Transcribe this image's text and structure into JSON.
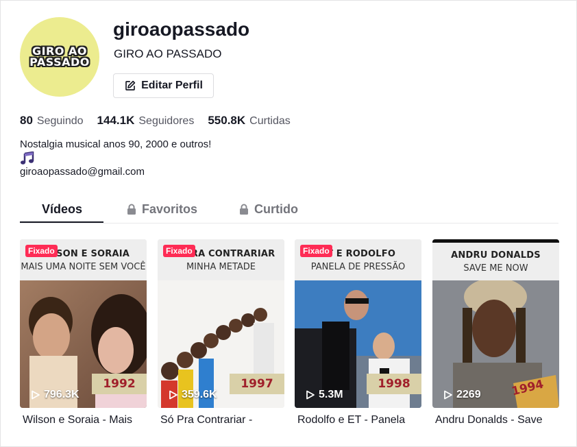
{
  "profile": {
    "avatar_text_line1": "GIRO AO",
    "avatar_text_line2": "PASSADO",
    "username": "giroaopassado",
    "nickname": "GIRO AO PASSADO",
    "edit_button_label": "Editar Perfil"
  },
  "stats": [
    {
      "value": "80",
      "label": "Seguindo"
    },
    {
      "value": "144.1K",
      "label": "Seguidores"
    },
    {
      "value": "550.8K",
      "label": "Curtidas"
    }
  ],
  "bio": {
    "text": "Nostalgia musical anos 90, 2000 e outros!",
    "icon": "music-note-icon",
    "email": "giroaopassado@gmail.com"
  },
  "tabs": [
    {
      "label": "Vídeos",
      "active": true,
      "locked": false
    },
    {
      "label": "Favoritos",
      "active": false,
      "locked": true
    },
    {
      "label": "Curtido",
      "active": false,
      "locked": true
    }
  ],
  "videos": [
    {
      "pinned_label": "Fixado",
      "header_line1": "WILSON E SORAIA",
      "header_line2": "MAIS UMA NOITE SEM VOCÊ",
      "year": "1992",
      "views": "796.3K",
      "caption": "Wilson e Soraia - Mais"
    },
    {
      "pinned_label": "Fixado",
      "header_line1": "SÓ PRA CONTRARIAR",
      "header_line2": "MINHA METADE",
      "year": "1997",
      "views": "359.6K",
      "caption": "Só Pra Contrariar -"
    },
    {
      "pinned_label": "Fixado",
      "header_line1": "ET E RODOLFO",
      "header_line2": "PANELA DE PRESSÃO",
      "year": "1998",
      "views": "5.3M",
      "caption": "Rodolfo e ET - Panela"
    },
    {
      "pinned_label": "",
      "header_line1": "ANDRU DONALDS",
      "header_line2": "SAVE ME NOW",
      "year": "1994",
      "views": "2269",
      "caption": "Andru Donalds - Save"
    }
  ],
  "colors": {
    "avatar_bg": "#ecec8f",
    "pinned_badge": "#fe2c55",
    "year_text": "#a0202b",
    "year_bg": "#d9d0a8"
  }
}
